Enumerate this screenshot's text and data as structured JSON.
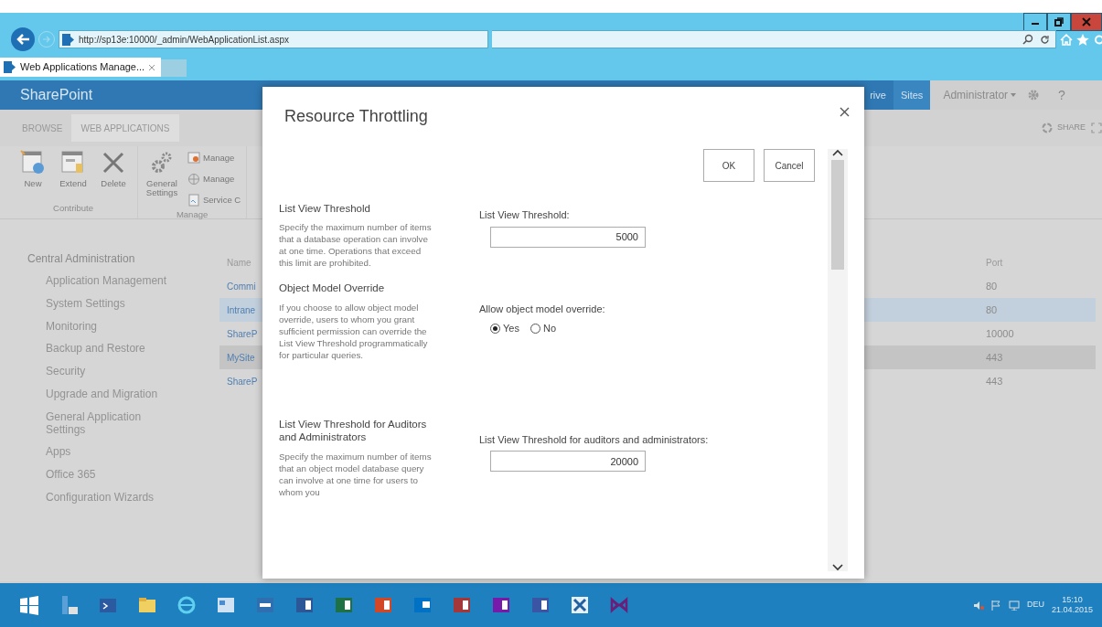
{
  "browser": {
    "address": "http://sp13e:10000/_admin/WebApplicationList.aspx",
    "tabs": [
      {
        "label": "Web Applications Manage...",
        "selected": true
      }
    ]
  },
  "suite_bar": {
    "brand": "SharePoint",
    "links": [
      {
        "label": "rive",
        "selected": false
      },
      {
        "label": "Sites",
        "selected": true
      }
    ],
    "user": "Administrator",
    "help": "?"
  },
  "ribbon": {
    "tabs": [
      {
        "label": "BROWSE",
        "selected": false
      },
      {
        "label": "WEB APPLICATIONS",
        "selected": true
      }
    ],
    "share": "SHARE",
    "groups": [
      {
        "label": "Contribute",
        "buttons": [
          {
            "label": "New",
            "kind": "new"
          },
          {
            "label": "Extend",
            "kind": "extend"
          },
          {
            "label": "Delete",
            "kind": "delete"
          }
        ]
      },
      {
        "label": "Manage",
        "buttons": [
          {
            "label": "General Settings",
            "kind": "settings"
          }
        ],
        "small_buttons": [
          "Manage",
          "Manage",
          "Service C"
        ]
      }
    ]
  },
  "left_nav": {
    "heading": "Central Administration",
    "items": [
      "Application Management",
      "System Settings",
      "Monitoring",
      "Backup and Restore",
      "Security",
      "Upgrade and Migration",
      "General Application Settings",
      "Apps",
      "Office 365",
      "Configuration Wizards"
    ]
  },
  "table": {
    "columns": [
      "Name",
      "Port"
    ],
    "rows": [
      {
        "name": "Commi",
        "port": "80",
        "selected": false,
        "hovered": false
      },
      {
        "name": "Intrane",
        "port": "80",
        "selected": true,
        "hovered": false
      },
      {
        "name": "ShareP",
        "port": "10000",
        "selected": false,
        "hovered": false
      },
      {
        "name": "MySite",
        "port": "443",
        "selected": false,
        "hovered": true
      },
      {
        "name": "ShareP",
        "port": "443",
        "selected": false,
        "hovered": false
      }
    ]
  },
  "dialog": {
    "title": "Resource Throttling",
    "buttons": [
      "OK",
      "Cancel"
    ],
    "sections": [
      {
        "kind": "number",
        "title": "List View Threshold",
        "description": "Specify the maximum number of items that a database operation can involve at one time. Operations that exceed this limit are prohibited.",
        "label": "List View Threshold:",
        "value": "5000"
      },
      {
        "kind": "radio",
        "title": "Object Model Override",
        "description": "If you choose to allow object model override, users to whom you grant sufficient permission can override the List View Threshold programmatically for particular queries.",
        "label": "Allow object model override:",
        "options": [
          {
            "label": "Yes",
            "selected": true
          },
          {
            "label": "No",
            "selected": false
          }
        ]
      },
      {
        "kind": "number",
        "title": "List View Threshold for Auditors and Administrators",
        "description": "Specify the maximum number of items that an object model database query can involve at one time for users to whom you",
        "label": "List View Threshold for auditors and administrators:",
        "value": "20000"
      }
    ]
  },
  "taskbar": {
    "language": "DEU",
    "time": "15:10",
    "date": "21.04.2015"
  }
}
